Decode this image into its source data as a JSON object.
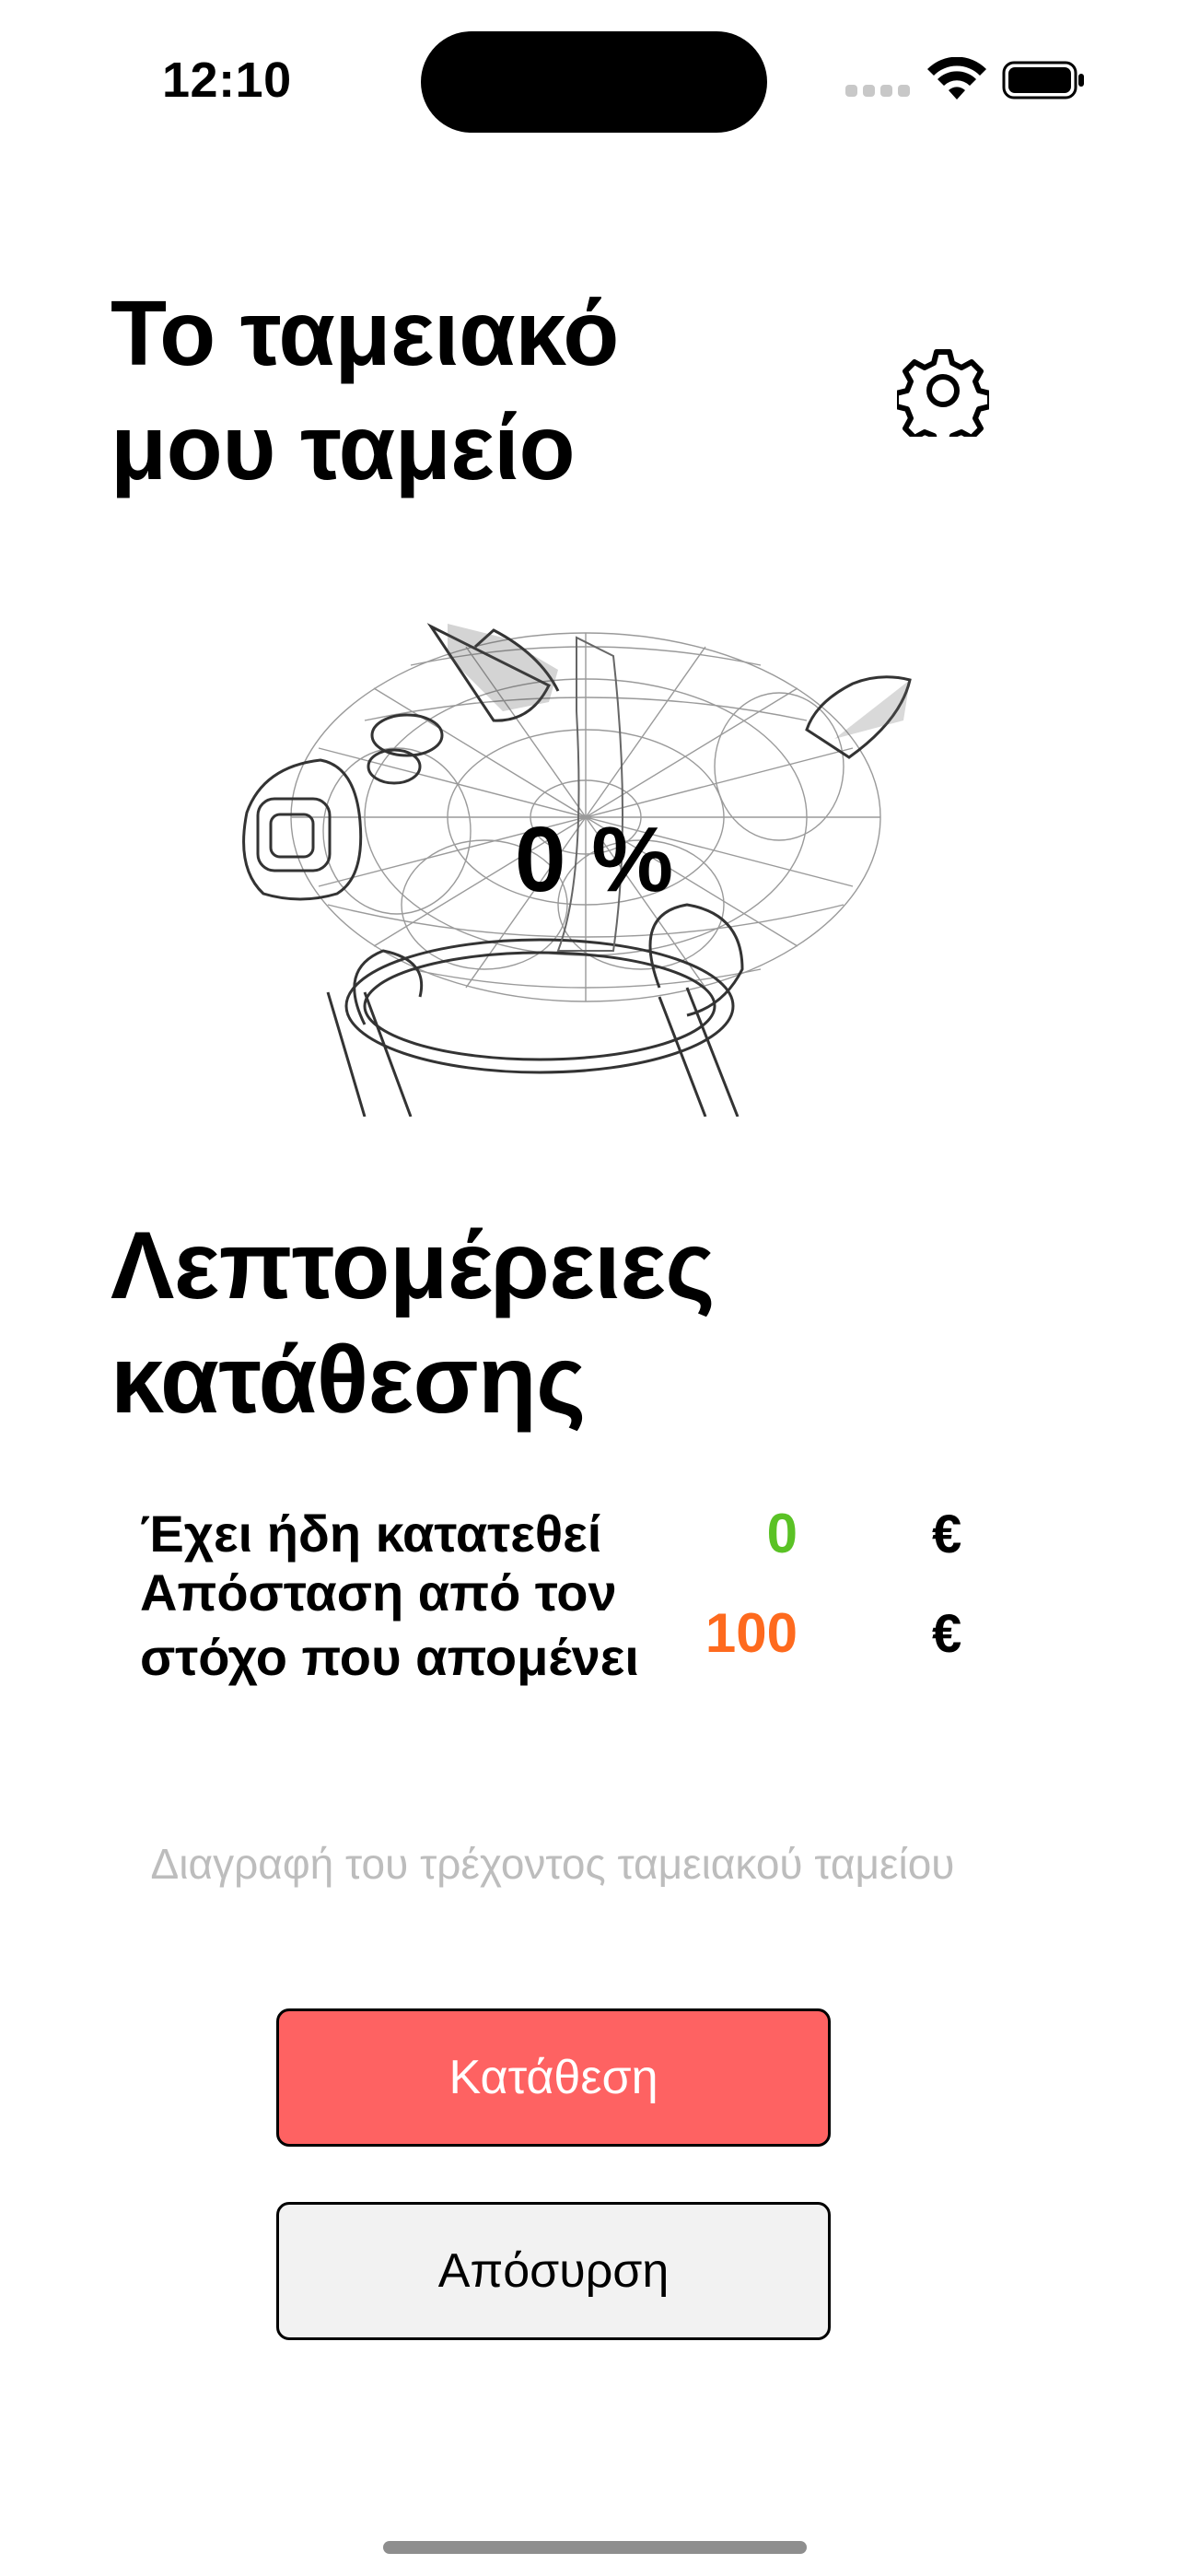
{
  "status_bar": {
    "time": "12:10"
  },
  "header": {
    "title_line1": "Το ταμειακό",
    "title_line2": "μου ταμείο",
    "settings_icon": "gear-icon"
  },
  "piggy": {
    "progress_text": "0 %",
    "progress_fraction": 0
  },
  "details": {
    "title_line1": "Λεπτομέρειες",
    "title_line2": "κατάθεσης",
    "rows": [
      {
        "label_line1": "Έχει ήδη κατατεθεί",
        "value": "0",
        "currency": "€",
        "color": "#5ac225"
      },
      {
        "label_line1": "Απόσταση από τον",
        "label_line2": "στόχο που απομένει",
        "value": "100",
        "currency": "€",
        "color": "#fe6a1e"
      }
    ]
  },
  "actions": {
    "delete_label": "Διαγραφή του τρέχοντος ταμειακού ταμείου",
    "deposit_label": "Κατάθεση",
    "withdraw_label": "Απόσυρση"
  },
  "colors": {
    "deposit_bg": "#fe6262",
    "withdraw_bg": "#f2f2f2",
    "muted_text": "#bdbdbd"
  }
}
